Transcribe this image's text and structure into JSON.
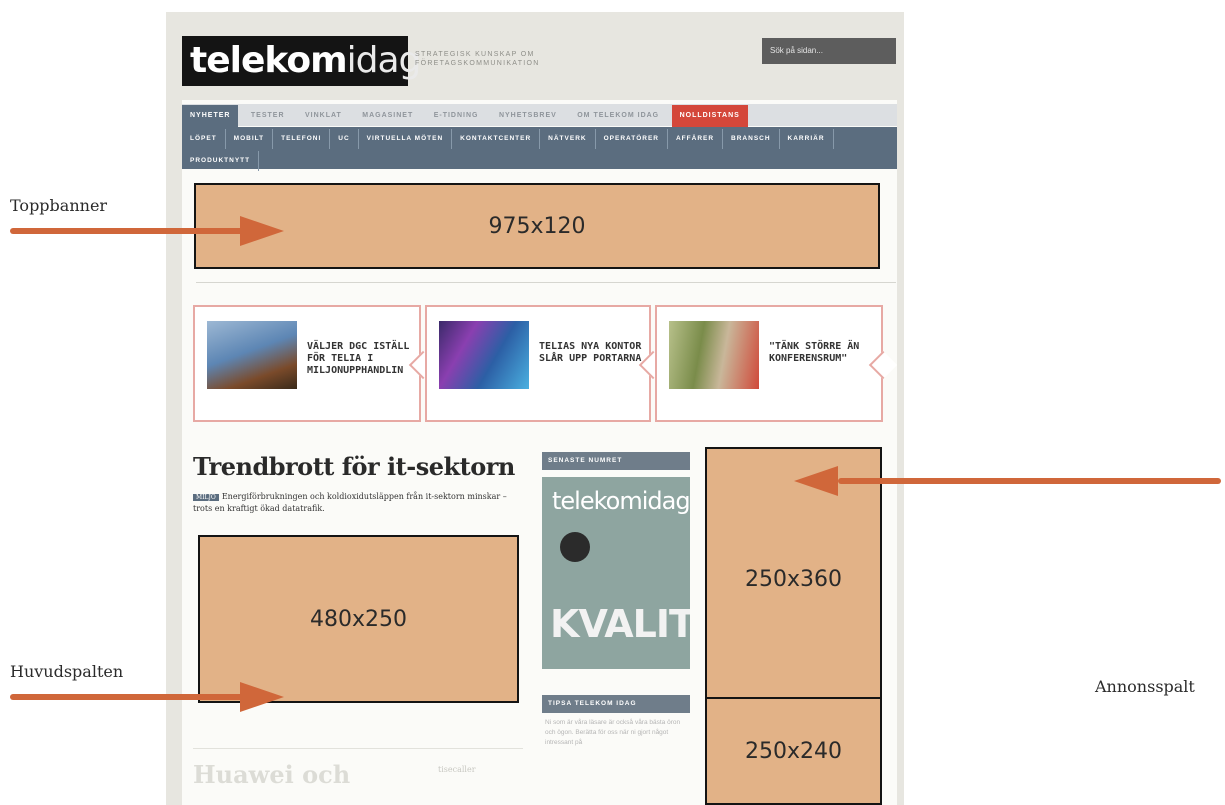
{
  "site": {
    "logo_bold": "telekom",
    "logo_light": "idag",
    "tagline": "STRATEGISK KUNSKAP OM FÖRETAGSKOMMUNIKATION",
    "search_placeholder": "Sök på sidan..."
  },
  "nav": {
    "top": [
      "NYHETER",
      "TESTER",
      "VINKLAT",
      "MAGASINET",
      "E-TIDNING",
      "NYHETSBREV",
      "OM TELEKOM IDAG",
      "NOLLDISTANS"
    ],
    "sub": [
      "LÖPET",
      "MOBILT",
      "TELEFONI",
      "UC",
      "VIRTUELLA MÖTEN",
      "KONTAKTCENTER",
      "NÄTVERK",
      "OPERATÖRER",
      "AFFÄRER",
      "BRANSCH",
      "KARRIÄR",
      "PRODUKTNYTT"
    ]
  },
  "ads": {
    "top_banner": "975x120",
    "main_column": "480x250",
    "side_large": "250x360",
    "side_small": "250x240"
  },
  "teasers": [
    {
      "text": "VÄLJER DGC ISTÄLL FÖR TELIA I MILJONUPPHANDLIN"
    },
    {
      "text": "TELIAS NYA KONTOR SLÅR UPP PORTARNA"
    },
    {
      "text": "\"TÄNK STÖRRE ÄN KONFERENSRUM\""
    }
  ],
  "article": {
    "headline": "Trendbrott för it-sektorn",
    "tag": "MILJÖ",
    "lead": "Energiförbrukningen och koldioxidutsläppen från it-sektorn minskar – trots en kraftigt ökad datatrafik."
  },
  "sidebar": {
    "latest_issue": "SENASTE NUMRET",
    "cover_title": "telekomidag",
    "cover_headline": "KVALITET",
    "tip_header": "TIPSA TELEKOM IDAG",
    "tip_text": "Ni som är våra läsare är också våra bästa öron och ögon. Berätta för oss när ni gjort något intressant på"
  },
  "next_article": {
    "headline": "Huawei och",
    "meta": "tisecaller"
  },
  "annotations": {
    "top_banner": "Toppbanner",
    "main_column": "Huvudspalten",
    "ad_column": "Annonsspalt"
  },
  "colors": {
    "ad_fill": "#e2b287",
    "arrow": "#d0673a",
    "nav_active": "#5b6d7f",
    "nav_red": "#d4473a"
  }
}
